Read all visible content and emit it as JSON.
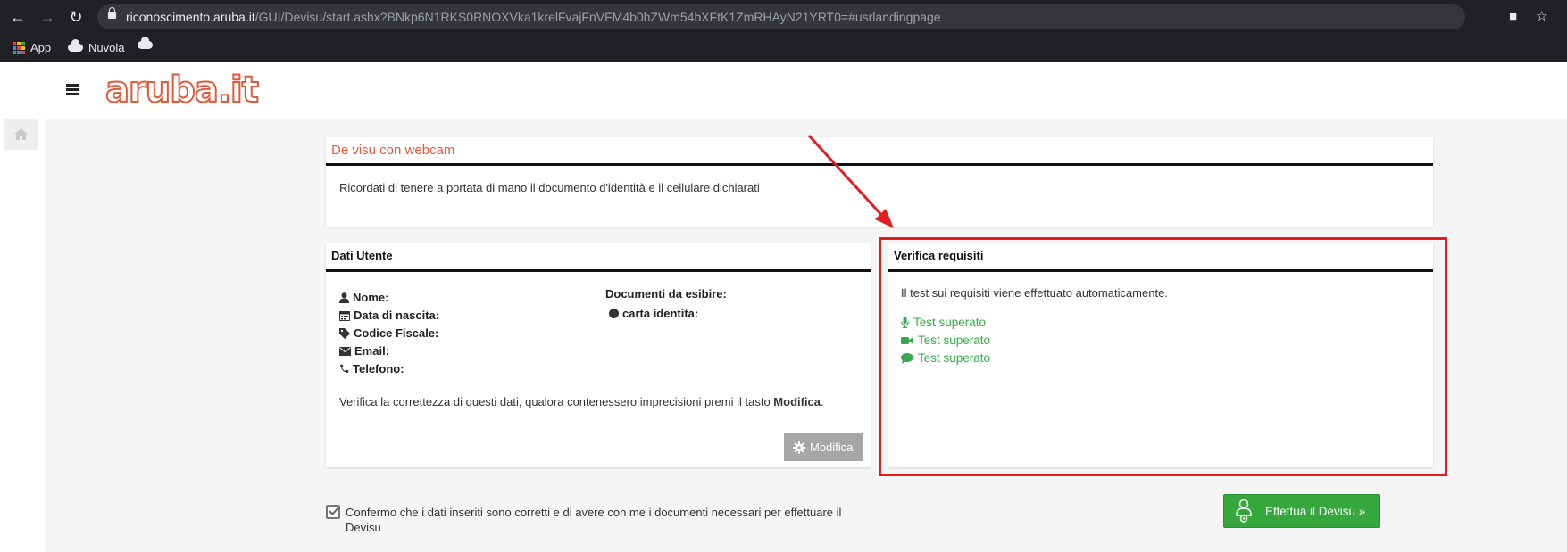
{
  "browser": {
    "url_host": "riconoscimento.aruba.it",
    "url_path": "/GUI/Devisu/start.ashx?BNkp6N1RKS0RNOXVka1krelFvajFnVFM4b0hZWm54bXFtK1ZmRHAyN21YRT0=#usrlandingpage",
    "bookmarks": [
      "App",
      "Nuvola"
    ]
  },
  "site": {
    "logo_text": "aruba.it"
  },
  "webcam_panel": {
    "title": "De visu con webcam",
    "text": "Ricordati di tenere a portata di mano il documento d'identità e il cellulare dichiarati"
  },
  "user_panel": {
    "title": "Dati Utente",
    "fields": [
      "Nome:",
      "Data di nascita:",
      "Codice Fiscale:",
      "Email:",
      "Telefono:"
    ],
    "documents_label": "Documenti da esibire:",
    "document_item": "carta identita:",
    "verify_text_before": "Verifica la correttezza di questi dati, qualora contenessero imprecisioni premi il tasto ",
    "verify_text_strong": "Modifica",
    "verify_text_after": ".",
    "edit_button": "Modifica"
  },
  "requirements_panel": {
    "title": "Verifica requisiti",
    "text": "Il test sui requisiti viene effettuato automaticamente.",
    "tests": [
      {
        "icon": "microphone-icon",
        "label": "Test superato"
      },
      {
        "icon": "video-camera-icon",
        "label": "Test superato"
      },
      {
        "icon": "chat-bubble-icon",
        "label": "Test superato"
      }
    ]
  },
  "footer": {
    "confirm_text": "Confermo che i dati inseriti sono corretti e di avere con me i documenti necessari per effettuare il Devisu",
    "confirm_checked": true,
    "start_button": "Effettua il Devisu »"
  },
  "colors": {
    "brand": "#e2593a",
    "success": "#3aa84a",
    "annotation": "#e01e1e"
  }
}
